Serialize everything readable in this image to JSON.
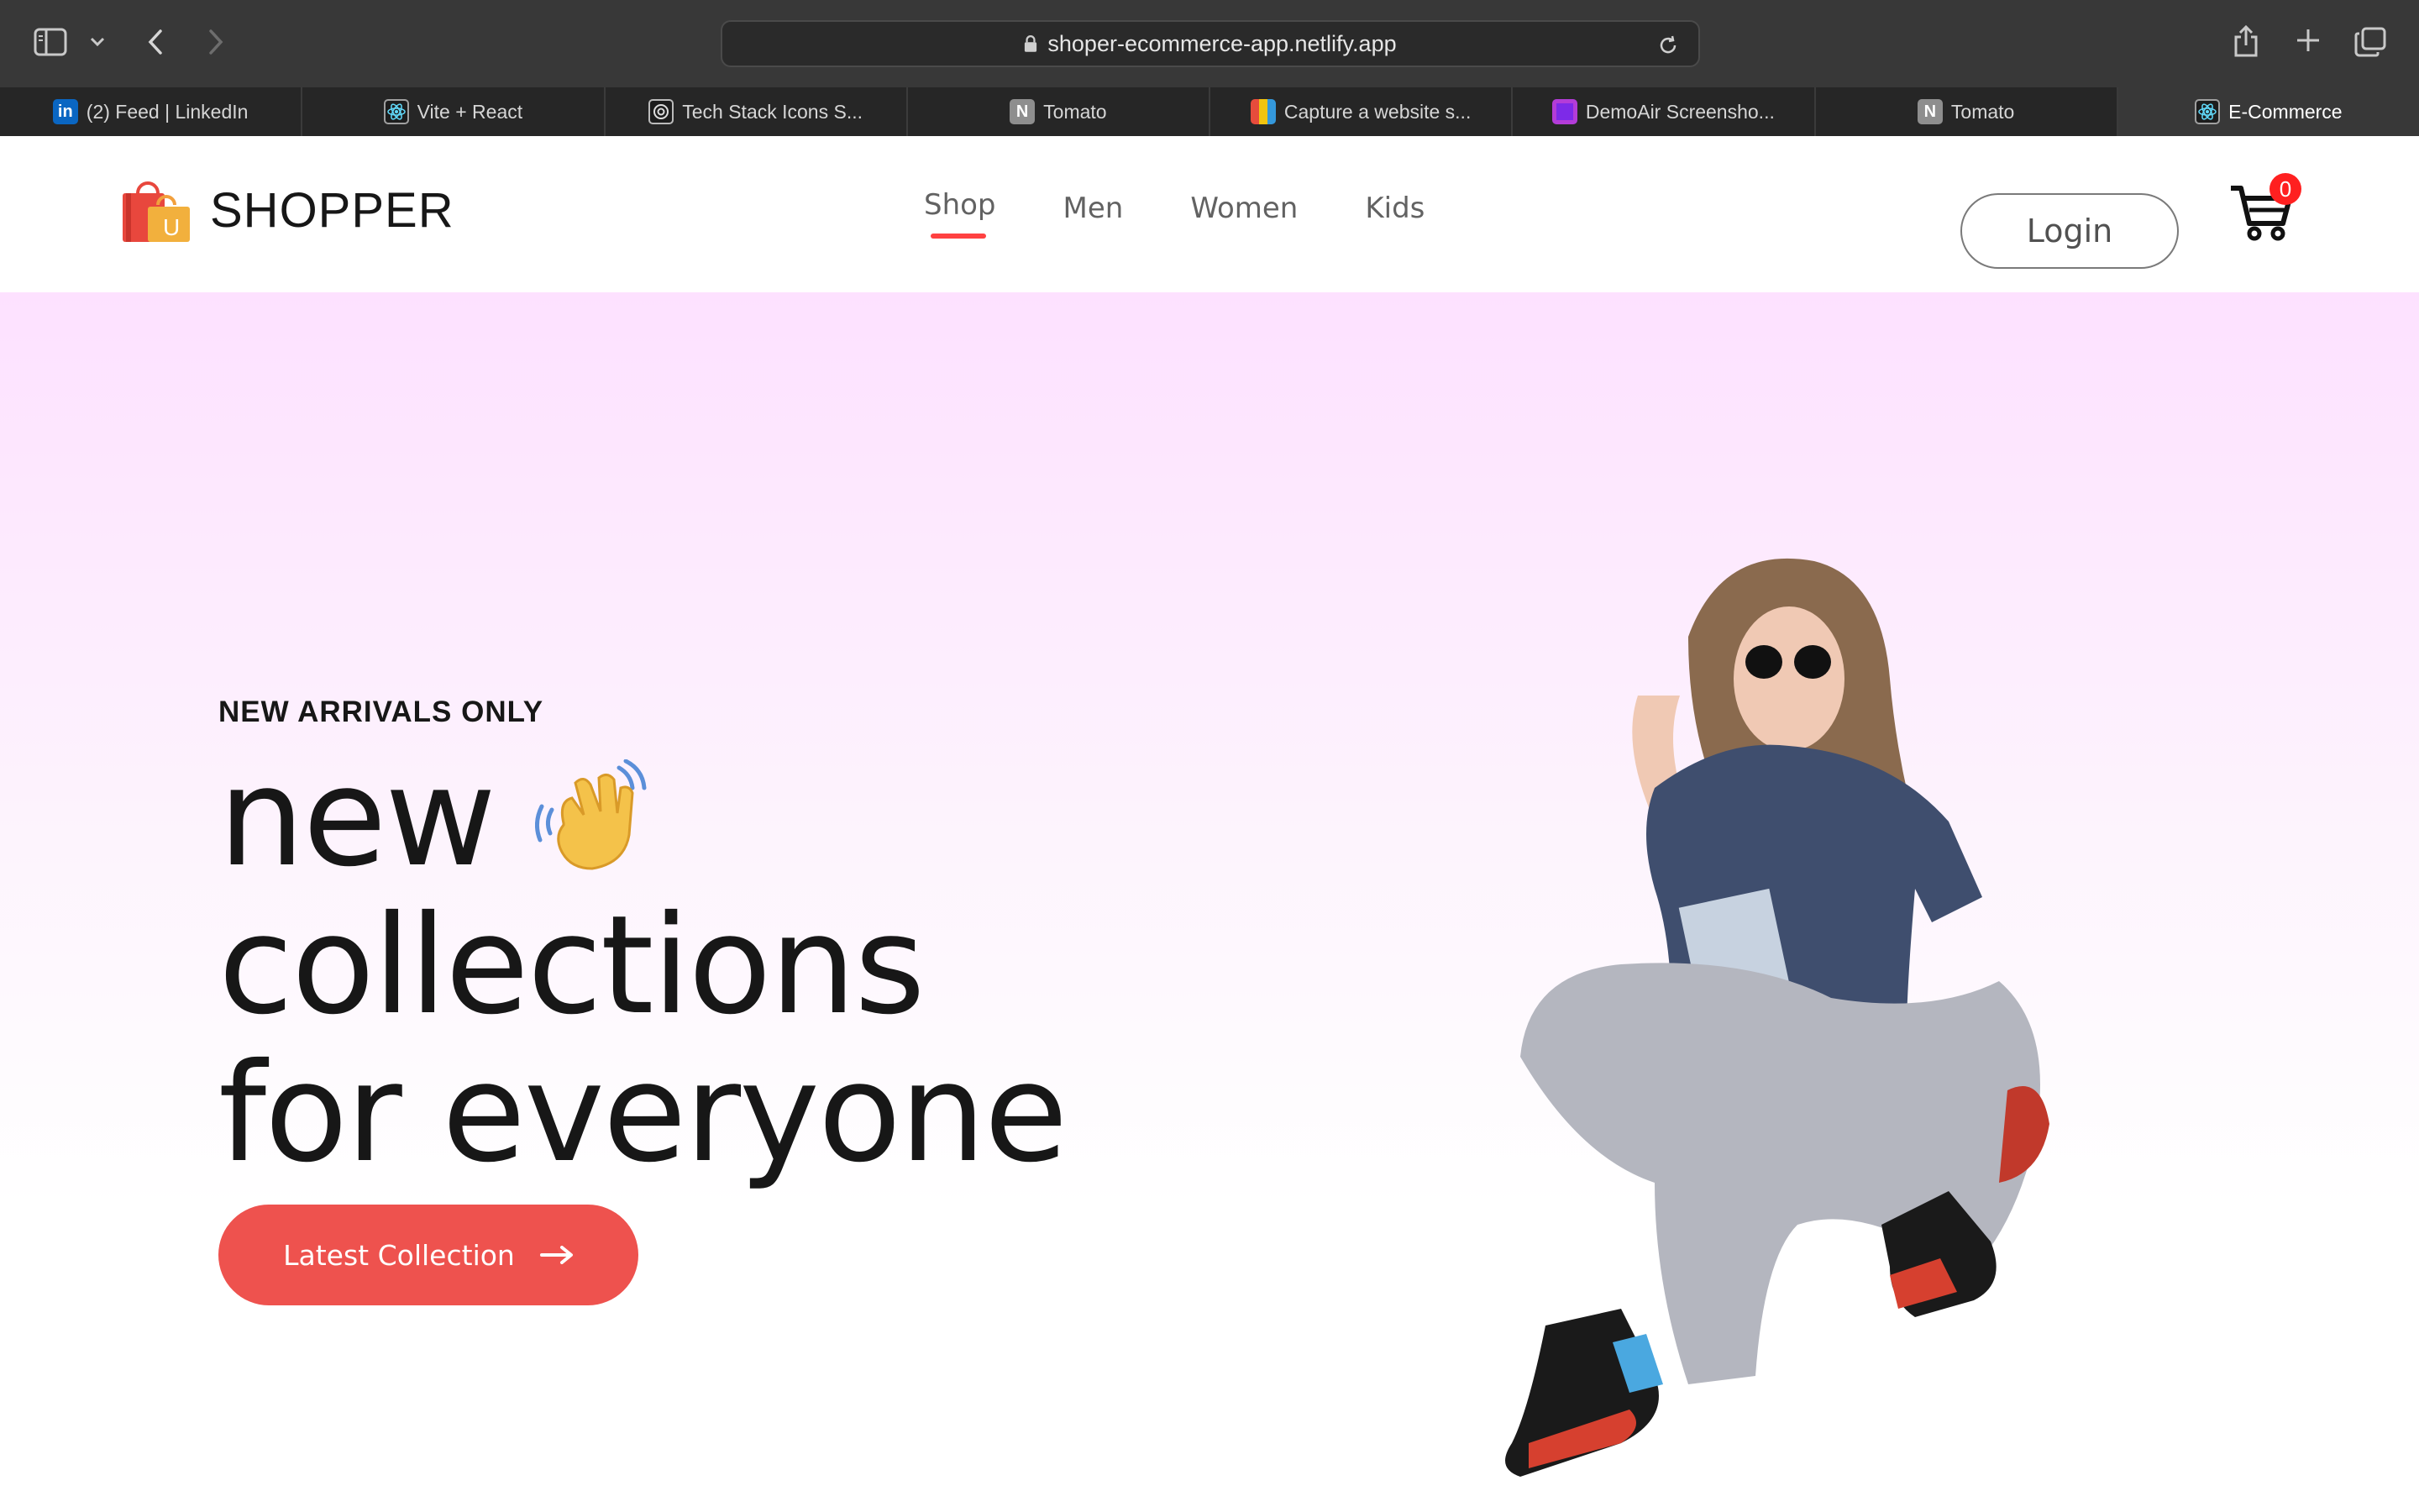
{
  "browser": {
    "url": "shoper-ecommerce-app.netlify.app",
    "tabs": [
      {
        "title": "(2) Feed | LinkedIn",
        "icon": "linkedin-icon"
      },
      {
        "title": "Vite + React",
        "icon": "react-icon"
      },
      {
        "title": "Tech Stack Icons S...",
        "icon": "openai-icon"
      },
      {
        "title": "Tomato",
        "icon": "notion-icon"
      },
      {
        "title": "Capture a website s...",
        "icon": "grid-icon"
      },
      {
        "title": "DemoAir Screensho...",
        "icon": "demoair-icon"
      },
      {
        "title": "Tomato",
        "icon": "notion-icon"
      },
      {
        "title": "E-Commerce",
        "icon": "react-icon",
        "active": true
      }
    ]
  },
  "site": {
    "logo_text": "SHOPPER",
    "logo_badge": "U",
    "nav": [
      "Shop",
      "Men",
      "Women",
      "Kids"
    ],
    "active_nav": "Shop",
    "login_label": "Login",
    "cart_count": "0",
    "accent_color": "#ee524e"
  },
  "hero": {
    "eyebrow": "NEW ARRIVALS ONLY",
    "line1": "new",
    "line2": "collections",
    "line3": "for everyone",
    "cta_label": "Latest Collection",
    "cta_arrow": "⟶"
  }
}
